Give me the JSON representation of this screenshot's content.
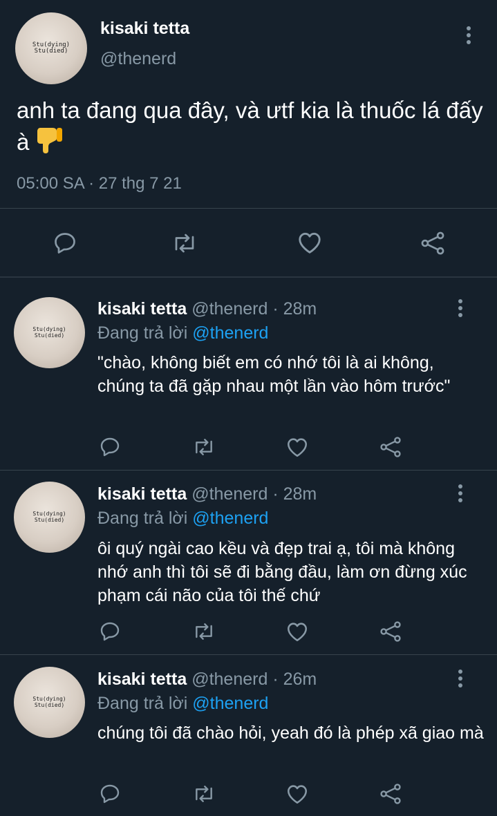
{
  "main_tweet": {
    "author_name": "kisaki tetta",
    "author_handle": "@thenerd",
    "avatar_line1": "Stu(dying)",
    "avatar_line2": "Stu(died)",
    "text": "anh ta đang qua đây, và ưtf kia là thuốc lá đấy à",
    "emoji": "thumbs-down",
    "timestamp": "05:00 SA · 27 thg 7 21"
  },
  "replies": [
    {
      "author_name": "kisaki tetta",
      "author_handle": "@thenerd",
      "time": "· 28m",
      "replying_prefix": "Đang trả lời",
      "replying_to": "@thenerd",
      "text": "\"chào, không biết em có nhớ tôi là ai không, chúng ta đã gặp nhau một lần vào hôm trước\""
    },
    {
      "author_name": "kisaki tetta",
      "author_handle": "@thenerd",
      "time": "· 28m",
      "replying_prefix": "Đang trả lời",
      "replying_to": "@thenerd",
      "text": "ôi quý ngài cao kều và đẹp trai ạ, tôi mà không nhớ anh thì tôi sẽ đi bằng đầu, làm ơn đừng xúc phạm cái não của tôi thế chứ"
    },
    {
      "author_name": "kisaki tetta",
      "author_handle": "@thenerd",
      "time": "· 26m",
      "replying_prefix": "Đang trả lời",
      "replying_to": "@thenerd",
      "text": "chúng tôi đã chào hỏi, yeah đó là phép xã giao mà"
    }
  ],
  "icons": {
    "action_color": "#8899a6",
    "link_color": "#1da1f2",
    "background": "#15202b"
  }
}
